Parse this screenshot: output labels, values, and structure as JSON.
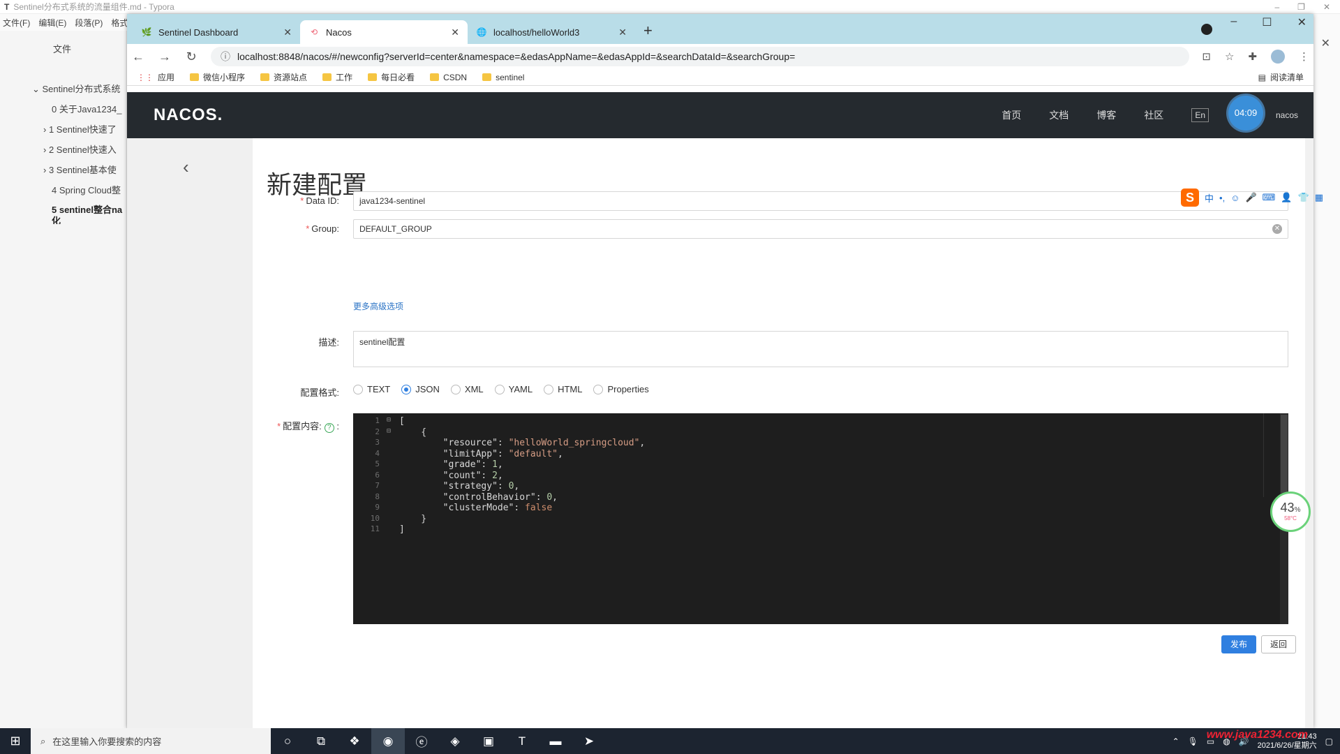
{
  "typora": {
    "title": "Sentinel分布式系统的流量组件.md - Typora",
    "app_letter": "T",
    "menu": [
      "文件(F)",
      "编辑(E)",
      "段落(P)",
      "格式"
    ],
    "files_label": "文件",
    "outline": [
      "Sentinel分布式系统",
      "0 关于Java1234_",
      "1 Sentinel快速了",
      "2 Sentinel快速入",
      "3 Sentinel基本使",
      "4 Spring Cloud整",
      "5 sentinel整合na 化"
    ]
  },
  "browser": {
    "tabs": [
      {
        "label": "Sentinel Dashboard",
        "icon": "leaf-icon",
        "active": false
      },
      {
        "label": "Nacos",
        "icon": "nacos-icon",
        "active": true
      },
      {
        "label": "localhost/helloWorld3",
        "icon": "globe-icon",
        "active": false
      }
    ],
    "url": "localhost:8848/nacos/#/newconfig?serverId=center&namespace=&edasAppName=&edasAppId=&searchDataId=&searchGroup=",
    "bookmarks": [
      "应用",
      "微信小程序",
      "资源站点",
      "工作",
      "每日必看",
      "CSDN",
      "sentinel"
    ],
    "reading_list": "阅读清单"
  },
  "nacos": {
    "logo": "NACOS.",
    "nav": [
      "首页",
      "文档",
      "博客",
      "社区"
    ],
    "lang": "En",
    "user": "nacos",
    "timer": "04:09",
    "page_title": "新建配置",
    "form": {
      "data_id_label": "Data ID:",
      "data_id_value": "java1234-sentinel",
      "group_label": "Group:",
      "group_value": "DEFAULT_GROUP",
      "more_options": "更多高级选项",
      "desc_label": "描述:",
      "desc_value": "sentinel配置",
      "format_label": "配置格式:",
      "formats": [
        "TEXT",
        "JSON",
        "XML",
        "YAML",
        "HTML",
        "Properties"
      ],
      "selected_format": "JSON",
      "content_label": "配置内容:",
      "publish": "发布",
      "back": "返回"
    },
    "code_lines": [
      "[",
      "    {",
      "        \"resource\": \"helloWorld_springcloud\",",
      "        \"limitApp\": \"default\",",
      "        \"grade\": 1,",
      "        \"count\": 2,",
      "        \"strategy\": 0,",
      "        \"controlBehavior\": 0,",
      "        \"clusterMode\": false",
      "    }",
      "]"
    ]
  },
  "overlay": {
    "cpu_percent": "43",
    "cpu_temp": "58°C",
    "ime_mode": "中"
  },
  "taskbar": {
    "search_placeholder": "在这里输入你要搜索的内容",
    "time": "21:43",
    "date": "2021/6/26/星期六",
    "watermark": "www.java1234.com"
  }
}
